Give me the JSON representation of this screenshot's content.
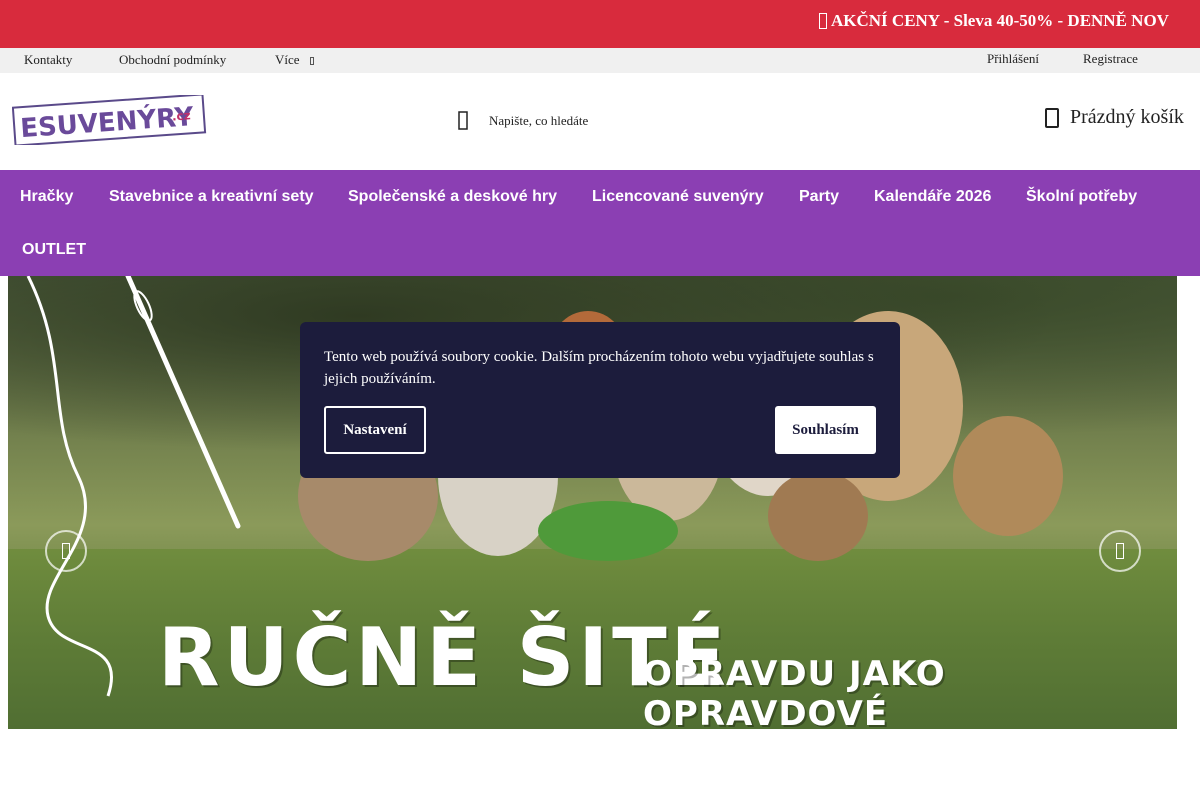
{
  "promo": {
    "text": "AKČNÍ CENY - Sleva 40-50% - DENNĚ NOV"
  },
  "topbar": {
    "links": [
      "Kontakty",
      "Obchodní podmínky",
      "Více"
    ],
    "account": [
      "Přihlášení",
      "Registrace"
    ]
  },
  "header": {
    "logo_text": "ESUVENÝRY",
    "logo_suffix": ".cz",
    "search_placeholder": "Napište, co hledáte",
    "cart_label": "Prázdný košík"
  },
  "nav": {
    "items": [
      "Hračky",
      "Stavebnice a kreativní sety",
      "Společenské a deskové hry",
      "Licencované suvenýry",
      "Party",
      "Kalendáře 2026",
      "Školní potřeby",
      "OUTLET"
    ]
  },
  "banner": {
    "headline": "RUČNĚ ŠITÉ",
    "subline": "OPRAVDU JAKO OPRAVDOVÉ"
  },
  "cookie": {
    "text": "Tento web používá soubory cookie. Dalším procházením tohoto webu vyjadřujete souhlas s jejich používáním.",
    "settings_label": "Nastavení",
    "accept_label": "Souhlasím"
  },
  "colors": {
    "promo_bg": "#d82b3d",
    "nav_bg": "#8b3fb3",
    "cookie_bg": "#1c1c3c"
  }
}
